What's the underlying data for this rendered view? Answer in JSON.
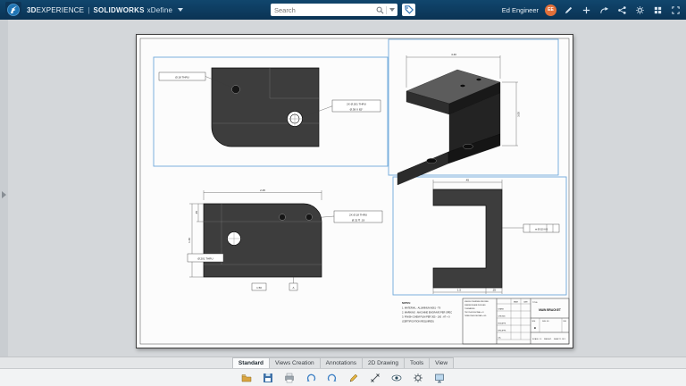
{
  "theme": {
    "topbar_color": "#0c3a5e",
    "selection_color": "#6fa9db",
    "avatar_color": "#e2703a",
    "part_color": "#3d3d3d"
  },
  "header": {
    "brand_3d": "3D",
    "brand_experience": "EXPERIENCE",
    "separator": "|",
    "app": "SOLIDWORKS",
    "workspace": "xDefine",
    "search_placeholder": "Search",
    "user_name": "Ed Engineer",
    "user_initials": "EE"
  },
  "drawing": {
    "notes_title": "NOTES:",
    "notes": [
      "1. MATERIAL : ALUMINUM 6061 - T6",
      "2. MARKING : MACHINE ENGRAVE PER SPEC",
      "3. FINISH CHEM FILM PER 305 - 100 : AT + 0",
      "    (CERTIFICATION REQUIRED)"
    ],
    "dims": {
      "tv_c1": "Ø.18 THRU",
      "tv_c2a": "2X Ø.201 THRU",
      "tv_c2b": "Ø.38 X 82°",
      "fv_w": "2.25",
      "fv_h1": ".45",
      "fv_h2": "1.40",
      "fv_c1a": "2X Ø.18 THRU",
      "fv_c1b": "Ø.32 ∇ .19",
      "fv_c2": "Ø.201 THRU",
      "fv_basic": "1.50",
      "fv_datum": "A",
      "sv_top": ".45",
      "sv_fcf": "⊕ Ø.010 A B",
      "sv_b1": "1.5",
      "sv_b2": ".25",
      "iso_w": "4.40",
      "iso_h": "3.00"
    },
    "titleblock": {
      "tol": [
        "UNLESS OTHERWISE SPECIFIED:",
        "DIMENSIONS ARE IN INCHES",
        "TOLERANCES:",
        "TWO PLACE DECIMAL   ±.01",
        "THREE PLACE DECIMAL ±.005"
      ],
      "name": "NAME",
      "date": "DATE",
      "roles": [
        "DRAWN",
        "CHECKED",
        "ENG APPR.",
        "MFG APPR.",
        "Q.A."
      ],
      "title_label": "TITLE:",
      "title": "MAIN BRACKET",
      "size_label": "SIZE",
      "size_val": "B",
      "dwg_label": "DWG. NO.",
      "rev_label": "REV",
      "scale": "SCALE: 1:1",
      "weight": "WEIGHT:",
      "sheet": "SHEET 1 OF 1"
    }
  },
  "footer": {
    "tabs": [
      {
        "label": "Standard",
        "active": true
      },
      {
        "label": "Views Creation",
        "active": false
      },
      {
        "label": "Annotations",
        "active": false
      },
      {
        "label": "2D Drawing",
        "active": false
      },
      {
        "label": "Tools",
        "active": false
      },
      {
        "label": "View",
        "active": false
      }
    ]
  }
}
